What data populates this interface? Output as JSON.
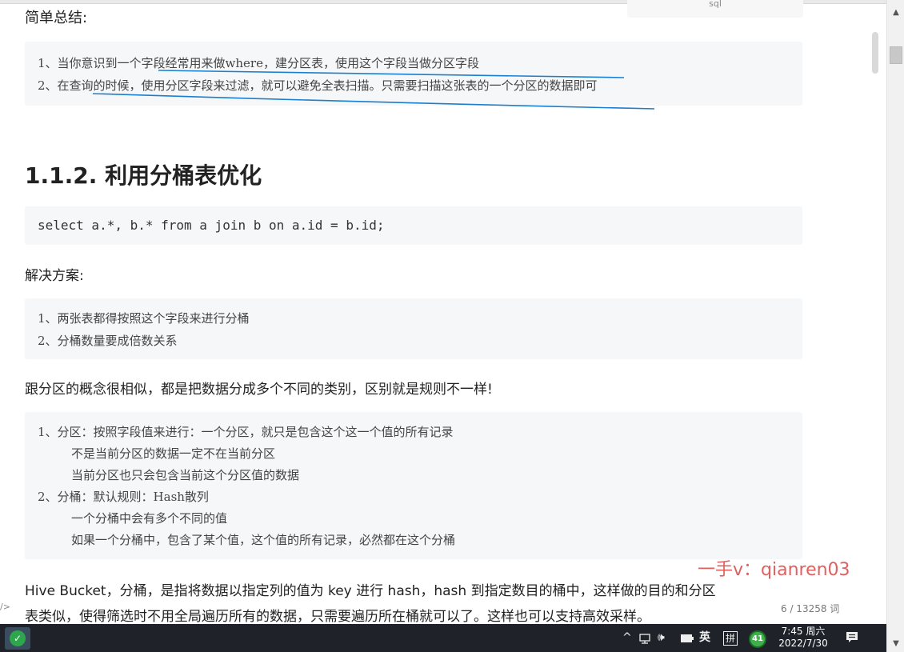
{
  "doc": {
    "top_snippet": "sql",
    "summary_heading": "简单总结:",
    "summary_items": [
      "1、当你意识到一个字段经常用来做where，建分区表，使用这个字段当做分区字段",
      "2、在查询的时候，使用分区字段来过滤，就可以避免全表扫描。只需要扫描这张表的一个分区的数据即可"
    ],
    "section_title": "1.1.2. 利用分桶表优化",
    "sql_code": "select a.*, b.* from a join b on a.id = b.id;",
    "solution_label": "解决方案:",
    "solution_items": [
      "1、两张表都得按照这个字段来进行分桶",
      "2、分桶数量要成倍数关系"
    ],
    "concept_text": "跟分区的概念很相似，都是把数据分成多个不同的类别，区别就是规则不一样!",
    "compare_lines": [
      "1、分区：按照字段值来进行：一个分区，就只是包含这个这一个值的所有记录",
      "不是当前分区的数据一定不在当前分区",
      "当前分区也只会包含当前这个分区值的数据",
      "2、分桶：默认规则：Hash散列",
      "一个分桶中会有多个不同的值",
      "如果一个分桶中，包含了某个值，这个值的所有记录，必然都在这个分桶"
    ],
    "hive_para_1": "Hive Bucket，分桶，是指将数据以指定列的值为 key 进行 hash，hash 到指定数目的桶中，这样做的目的和分区",
    "hive_para_2": "表类似，使得筛选时不用全局遍历所有的数据，只需要遍历所在桶就可以了。这样也可以支持高效采样。",
    "watermark": "一手v：qianren03",
    "word_count": "6 / 13258 词",
    "edge_marker": "/>",
    "annotation_color": "#1a7fd0"
  },
  "taskbar": {
    "tray_chevron": "^",
    "tray_volume": "🕪",
    "ime_lang": "英",
    "ime_mode": "拼",
    "badge_count": "41",
    "time": "7:45 周六",
    "date": "2022/7/30"
  },
  "scrollbar": {
    "up_arrow": "▲",
    "down_arrow": "▼"
  }
}
